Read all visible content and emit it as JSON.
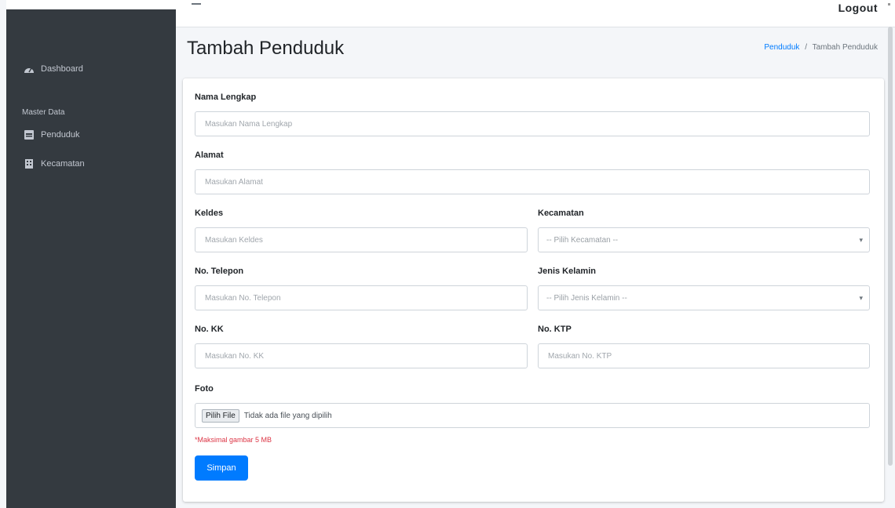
{
  "header": {
    "user_name": "Logout"
  },
  "sidebar": {
    "items": [
      {
        "label": "Dashboard",
        "icon": "dashboard-icon"
      },
      {
        "label": "Penduduk",
        "icon": "id-card-icon"
      },
      {
        "label": "Kecamatan",
        "icon": "building-icon"
      }
    ],
    "section_header": "Master Data"
  },
  "page": {
    "title": "Tambah Penduduk",
    "breadcrumb": {
      "parent": "Penduduk",
      "separator": "/",
      "current": "Tambah Penduduk"
    }
  },
  "form": {
    "nama": {
      "label": "Nama Lengkap",
      "placeholder": "Masukan Nama Lengkap"
    },
    "alamat": {
      "label": "Alamat",
      "placeholder": "Masukan Alamat"
    },
    "keldes": {
      "label": "Keldes",
      "placeholder": "Masukan Keldes"
    },
    "kecamatan": {
      "label": "Kecamatan",
      "selected": "-- Pilih Kecamatan --"
    },
    "telepon": {
      "label": "No. Telepon",
      "placeholder": "Masukan No. Telepon"
    },
    "jenis_kelamin": {
      "label": "Jenis Kelamin",
      "selected": "-- Pilih Jenis Kelamin --"
    },
    "kk": {
      "label": "No. KK",
      "placeholder": "Masukan No. KK"
    },
    "ktp": {
      "label": "No. KTP",
      "placeholder": "Masukan No. KTP"
    },
    "foto": {
      "label": "Foto",
      "button": "Pilih File",
      "status": "Tidak ada file yang dipilih",
      "hint": "*Maksimal gambar 5 MB"
    },
    "submit": "Simpan"
  },
  "colors": {
    "sidebar": "#343a40",
    "primary": "#007bff",
    "danger": "#dc3545"
  }
}
